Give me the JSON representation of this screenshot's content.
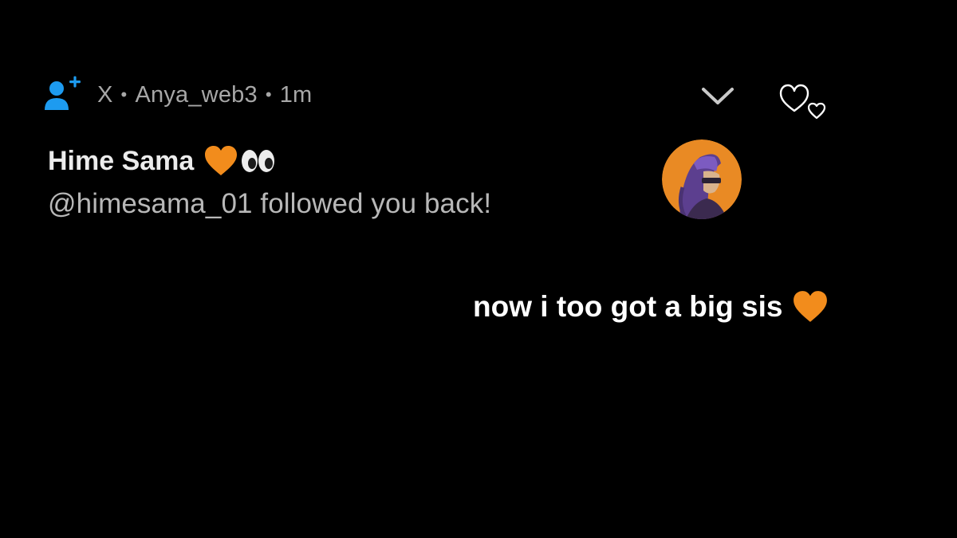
{
  "notification": {
    "source_app": "X",
    "account": "Anya_web3",
    "time": "1m",
    "separator": "•",
    "title": "Hime Sama",
    "message": "@himesama_01 followed you back!",
    "icons": {
      "notification_type": "person-add-icon",
      "expand": "chevron-down-icon",
      "title_emoji_1": "orange-heart-emoji",
      "title_emoji_2": "eyes-emoji",
      "avatar": "anime-girl-avatar"
    }
  },
  "caption": {
    "text": "now i too got a big sis",
    "emoji": "orange-heart-emoji"
  },
  "decoration": {
    "hearts": "hearts-doodle-icon"
  },
  "colors": {
    "background": "#000000",
    "accent_blue": "#1d9bf0",
    "meta_text": "#a7a7a7",
    "orange": "#f28c1c"
  }
}
